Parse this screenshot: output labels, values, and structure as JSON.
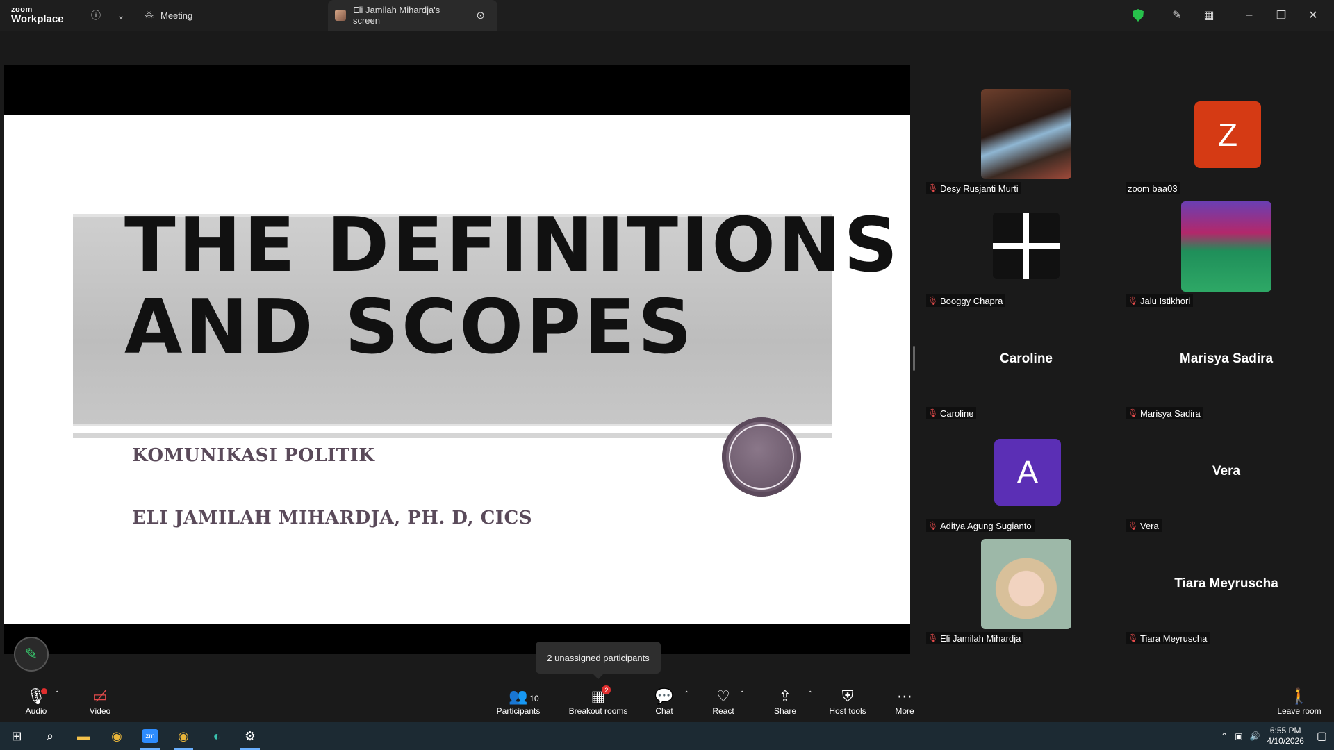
{
  "titlebar": {
    "brand_top": "zoom",
    "brand_bottom": "Workplace",
    "meeting_tab": "Meeting",
    "screen_tab": "Eli Jamilah Mihardja's screen"
  },
  "slide": {
    "title_line1": "THE DEFINITIONS",
    "title_line2": "AND SCOPES",
    "subtitle1": "KOMUNIKASI POLITIK",
    "subtitle2": "ELI JAMILAH MIHARDJA, PH. D, CICS"
  },
  "participants": [
    {
      "name": "Desy Rusjanti Murti",
      "kind": "photo"
    },
    {
      "name": "zoom baa03",
      "kind": "letter",
      "letter": "Z",
      "color": "#d53a14"
    },
    {
      "name": "Booggy Chapra",
      "kind": "photo"
    },
    {
      "name": "Jalu Istikhori",
      "kind": "photo"
    },
    {
      "name": "Caroline",
      "kind": "text"
    },
    {
      "name": "Marisya Sadira",
      "kind": "text"
    },
    {
      "name": "Aditya Agung Sugianto",
      "kind": "letter",
      "letter": "A",
      "color": "#5b2fb5"
    },
    {
      "name": "Vera",
      "kind": "text"
    },
    {
      "name": "Eli Jamilah Mihardja",
      "kind": "photo"
    },
    {
      "name": "Tiara Meyruscha",
      "kind": "text"
    }
  ],
  "tooltip": "2 unassigned participants",
  "toolbar": {
    "audio": "Audio",
    "video": "Video",
    "participants": "Participants",
    "participants_count": "10",
    "breakout": "Breakout rooms",
    "breakout_badge": "2",
    "chat": "Chat",
    "react": "React",
    "share": "Share",
    "host_tools": "Host tools",
    "more": "More",
    "leave": "Leave room"
  },
  "taskbar": {
    "time": "6:55 PM",
    "date": "4/10/2026"
  },
  "colors": {
    "accent_green": "#27c14b",
    "mic_muted": "#e34b4b",
    "slide_subtitle": "#5a4a5a"
  }
}
